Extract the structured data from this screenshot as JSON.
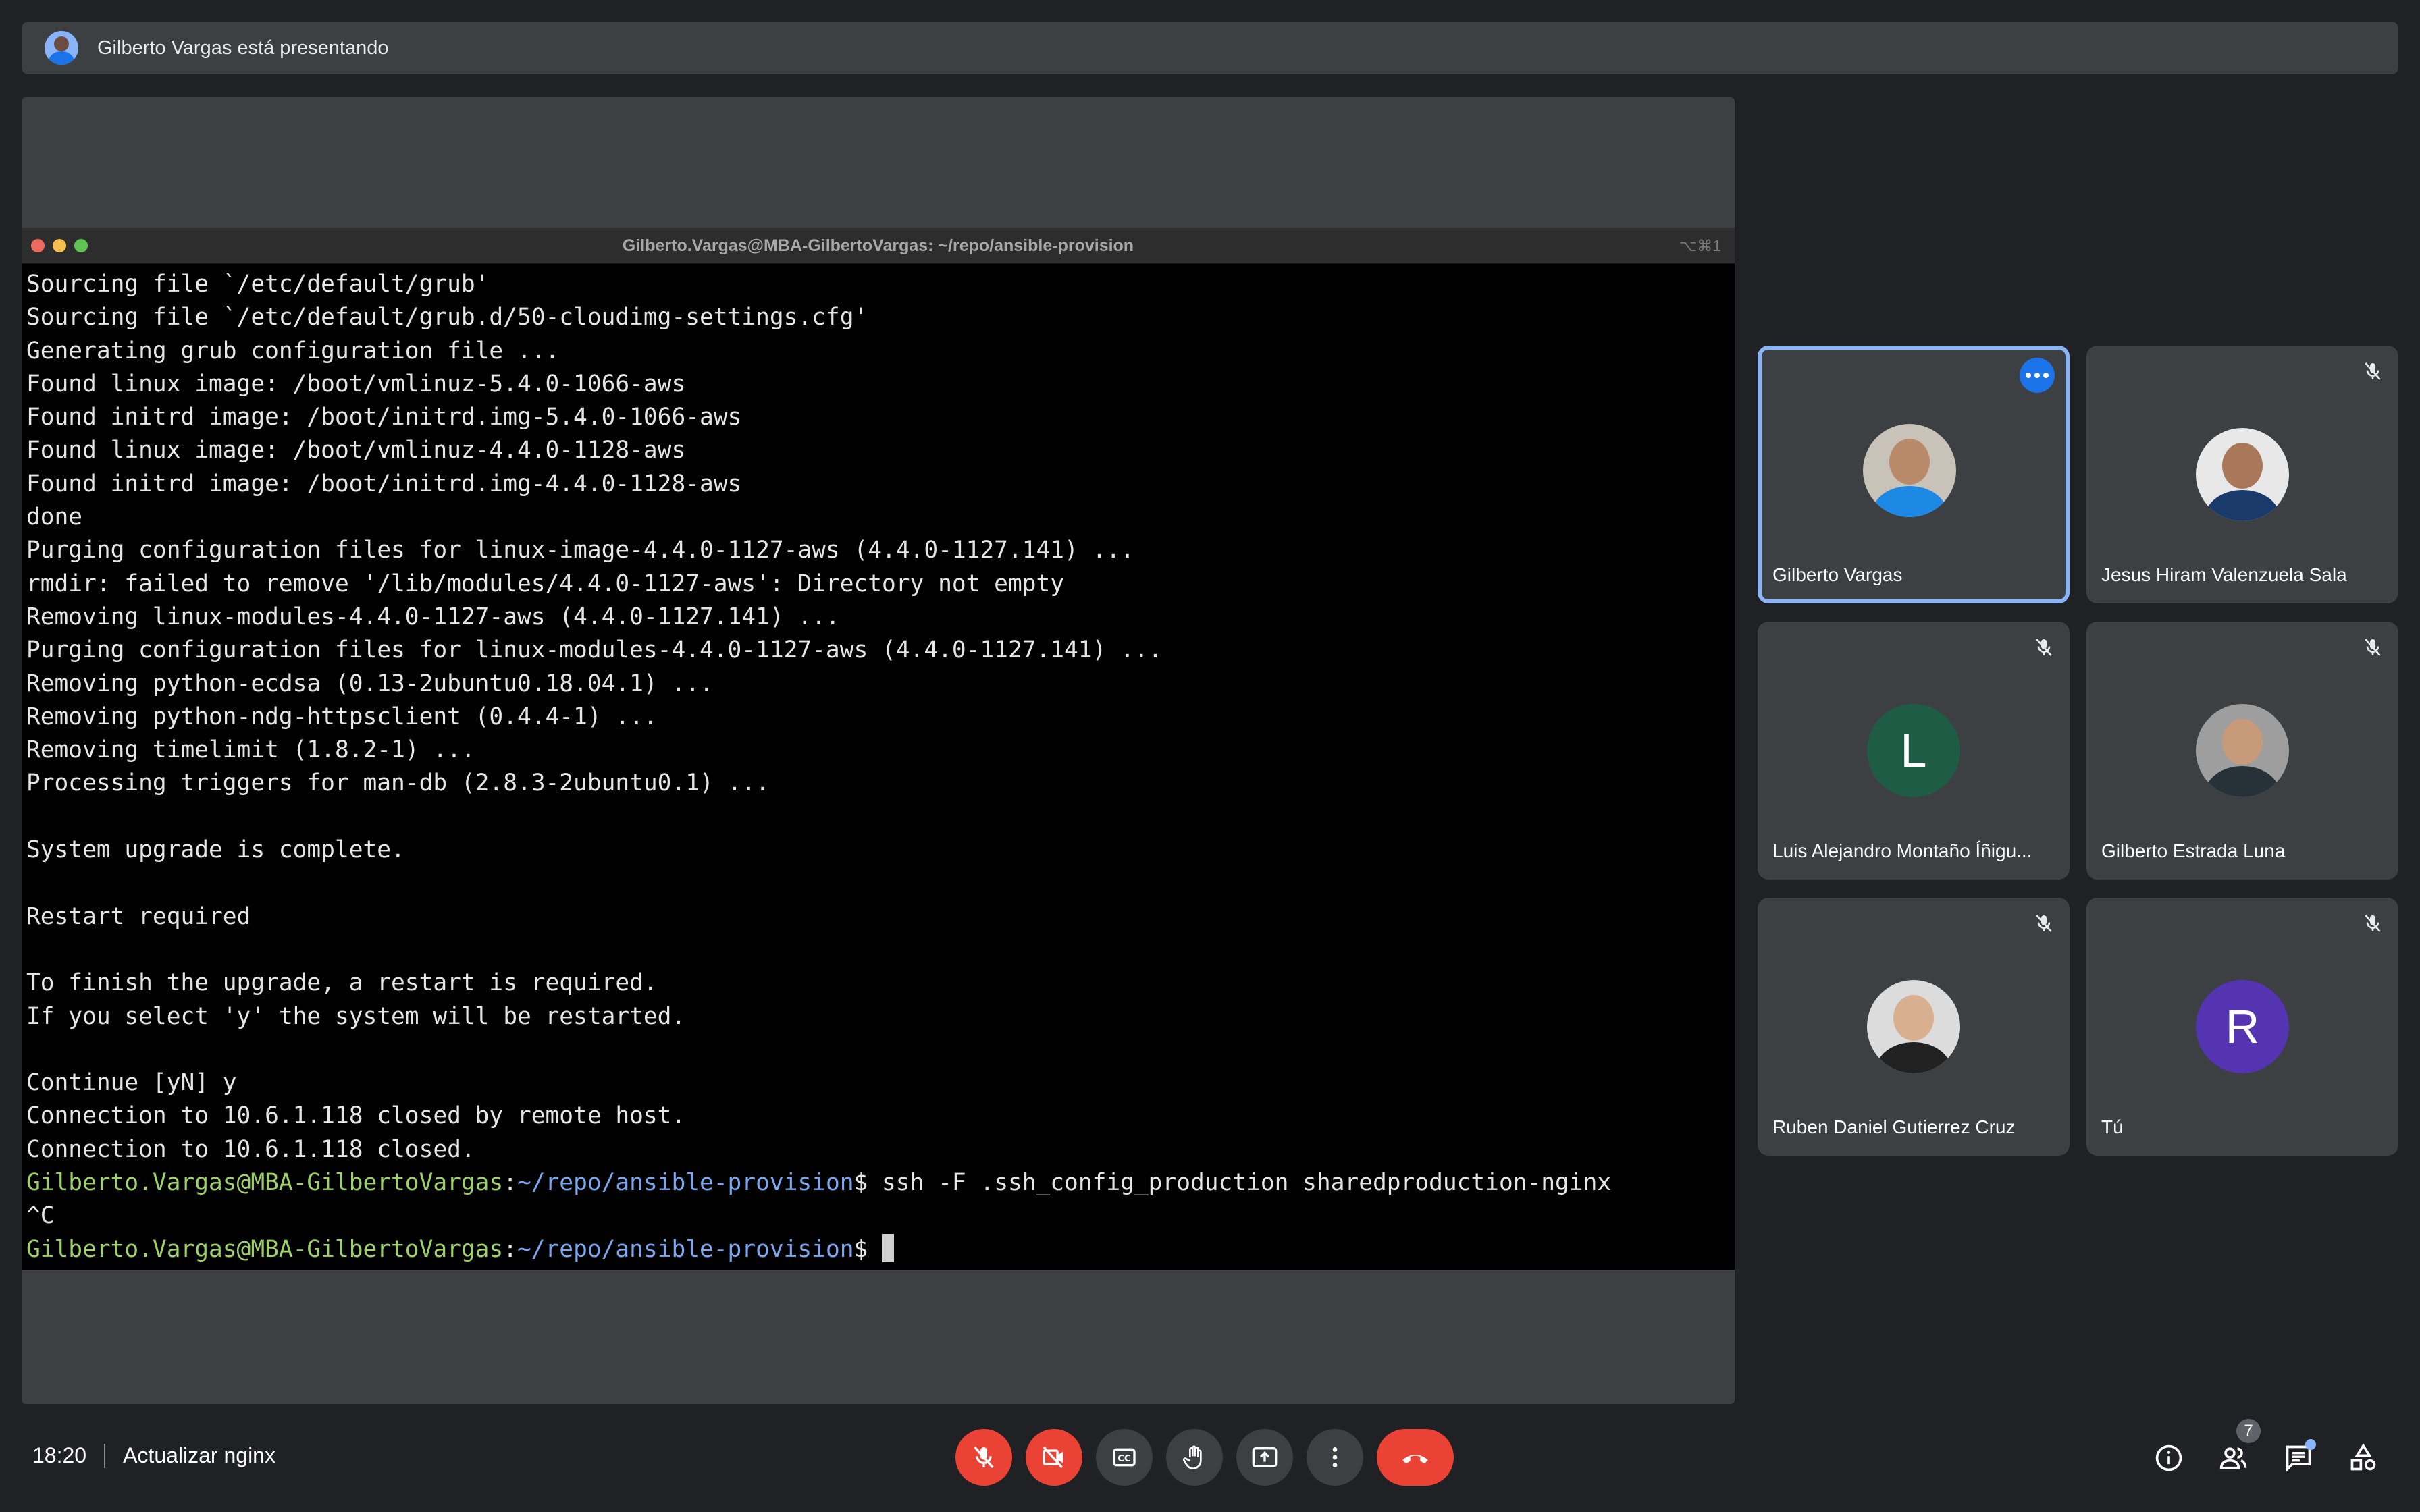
{
  "presenter_banner": "Gilberto Vargas está presentando",
  "terminal": {
    "title": "Gilberto.Vargas@MBA-GilbertoVargas: ~/repo/ansible-provision",
    "shortcut": "⌥⌘1",
    "traffic_colors": [
      "#ed6a5e",
      "#f5bf4f",
      "#61c554"
    ],
    "lines": [
      {
        "text": "Sourcing file `/etc/default/grub'"
      },
      {
        "text": "Sourcing file `/etc/default/grub.d/50-cloudimg-settings.cfg'"
      },
      {
        "text": "Generating grub configuration file ..."
      },
      {
        "text": "Found linux image: /boot/vmlinuz-5.4.0-1066-aws"
      },
      {
        "text": "Found initrd image: /boot/initrd.img-5.4.0-1066-aws"
      },
      {
        "text": "Found linux image: /boot/vmlinuz-4.4.0-1128-aws"
      },
      {
        "text": "Found initrd image: /boot/initrd.img-4.4.0-1128-aws"
      },
      {
        "text": "done"
      },
      {
        "text": "Purging configuration files for linux-image-4.4.0-1127-aws (4.4.0-1127.141) ..."
      },
      {
        "text": "rmdir: failed to remove '/lib/modules/4.4.0-1127-aws': Directory not empty"
      },
      {
        "text": "Removing linux-modules-4.4.0-1127-aws (4.4.0-1127.141) ..."
      },
      {
        "text": "Purging configuration files for linux-modules-4.4.0-1127-aws (4.4.0-1127.141) ..."
      },
      {
        "text": "Removing python-ecdsa (0.13-2ubuntu0.18.04.1) ..."
      },
      {
        "text": "Removing python-ndg-httpsclient (0.4.4-1) ..."
      },
      {
        "text": "Removing timelimit (1.8.2-1) ..."
      },
      {
        "text": "Processing triggers for man-db (2.8.3-2ubuntu0.1) ..."
      },
      {
        "text": ""
      },
      {
        "text": "System upgrade is complete."
      },
      {
        "text": ""
      },
      {
        "text": "Restart required"
      },
      {
        "text": ""
      },
      {
        "text": "To finish the upgrade, a restart is required."
      },
      {
        "text": "If you select 'y' the system will be restarted."
      },
      {
        "text": ""
      },
      {
        "text": "Continue [yN] y"
      },
      {
        "text": "Connection to 10.6.1.118 closed by remote host."
      },
      {
        "text": "Connection to 10.6.1.118 closed."
      },
      {
        "user": "Gilberto.Vargas@MBA-GilbertoVargas",
        "sep": ":",
        "path": "~/repo/ansible-provision",
        "cmd": "$ ssh -F .ssh_config_production sharedproduction-nginx"
      },
      {
        "text": "^C"
      },
      {
        "user": "Gilberto.Vargas@MBA-GilbertoVargas",
        "sep": ":",
        "path": "~/repo/ansible-provision",
        "cmd": "$ ",
        "cursor": true
      }
    ]
  },
  "participants": [
    {
      "name": "Gilberto Vargas",
      "type": "photo",
      "skin": "#b98a6a",
      "shirt": "#1e88e5",
      "bg": "#c9c2b8",
      "active": true,
      "muted": false
    },
    {
      "name": "Jesus Hiram Valenzuela Sala",
      "type": "photo",
      "skin": "#a9785a",
      "shirt": "#1a3a6b",
      "bg": "#e8e8e8",
      "muted": true
    },
    {
      "name": "Luis Alejandro Montaño Íñigu...",
      "type": "letter",
      "letter": "L",
      "bg": "#1f5c46",
      "muted": true
    },
    {
      "name": "Gilberto Estrada Luna",
      "type": "photo",
      "skin": "#c79a7a",
      "shirt": "#263238",
      "bg": "#9e9e9e",
      "muted": true
    },
    {
      "name": "Ruben Daniel Gutierrez Cruz",
      "type": "photo",
      "skin": "#d8b090",
      "shirt": "#212121",
      "bg": "#dcdcdc",
      "muted": true
    },
    {
      "name": "Tú",
      "type": "letter",
      "letter": "R",
      "bg": "#5434b0",
      "muted": true
    }
  ],
  "bottom": {
    "time": "18:20",
    "meeting_name": "Actualizar nginx",
    "participant_count": "7",
    "controls": [
      {
        "name": "mic-off",
        "color": "#ea4335"
      },
      {
        "name": "camera-off",
        "color": "#ea4335"
      },
      {
        "name": "captions",
        "color": "#3c4043"
      },
      {
        "name": "raise-hand",
        "color": "#3c4043"
      },
      {
        "name": "present",
        "color": "#3c4043"
      },
      {
        "name": "more-options",
        "color": "#3c4043"
      },
      {
        "name": "end-call",
        "color": "#ea4335"
      }
    ],
    "right_icons": [
      "info",
      "people",
      "chat",
      "activities"
    ]
  }
}
